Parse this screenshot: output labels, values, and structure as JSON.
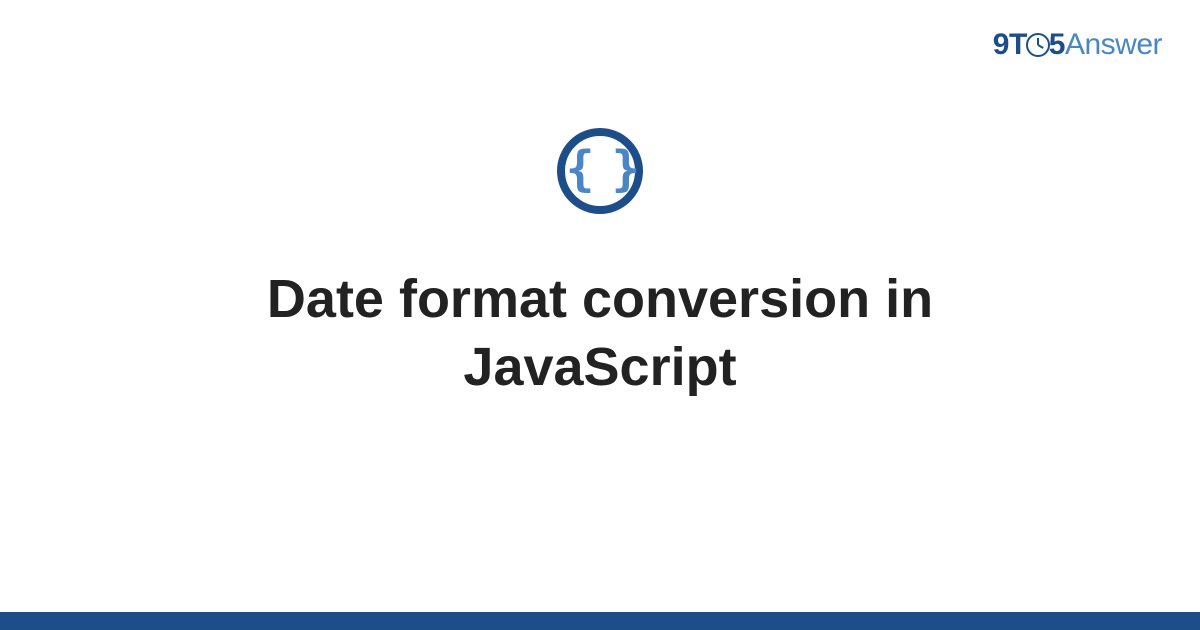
{
  "brand": {
    "nine": "9",
    "t": "T",
    "five": "5",
    "answer": "Answer"
  },
  "icon": {
    "braces": "{ }"
  },
  "title": "Date format conversion in JavaScript",
  "colors": {
    "primary": "#1d4e89",
    "accent": "#4a86c5",
    "text": "#222222"
  }
}
